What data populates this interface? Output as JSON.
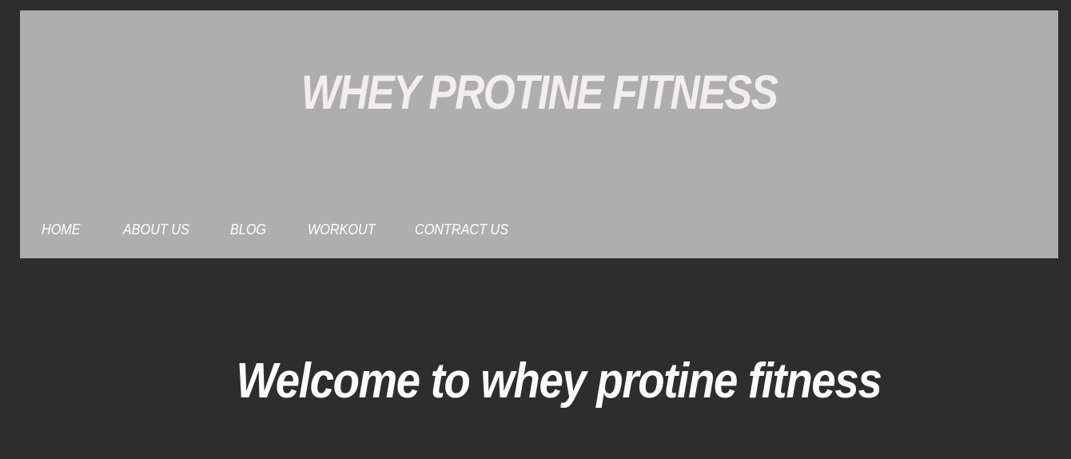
{
  "header": {
    "site_title": "WHEY PROTINE FITNESS",
    "background_color": "#aeaeae",
    "title_color": "#f3eeee"
  },
  "nav": {
    "items": [
      {
        "label": "HOME"
      },
      {
        "label": "ABOUT US"
      },
      {
        "label": "BLOG"
      },
      {
        "label": "WORKOUT"
      },
      {
        "label": "CONTRACT US"
      }
    ]
  },
  "main": {
    "welcome_heading": "Welcome to whey protine fitness",
    "background_color": "#2d2d2d"
  }
}
